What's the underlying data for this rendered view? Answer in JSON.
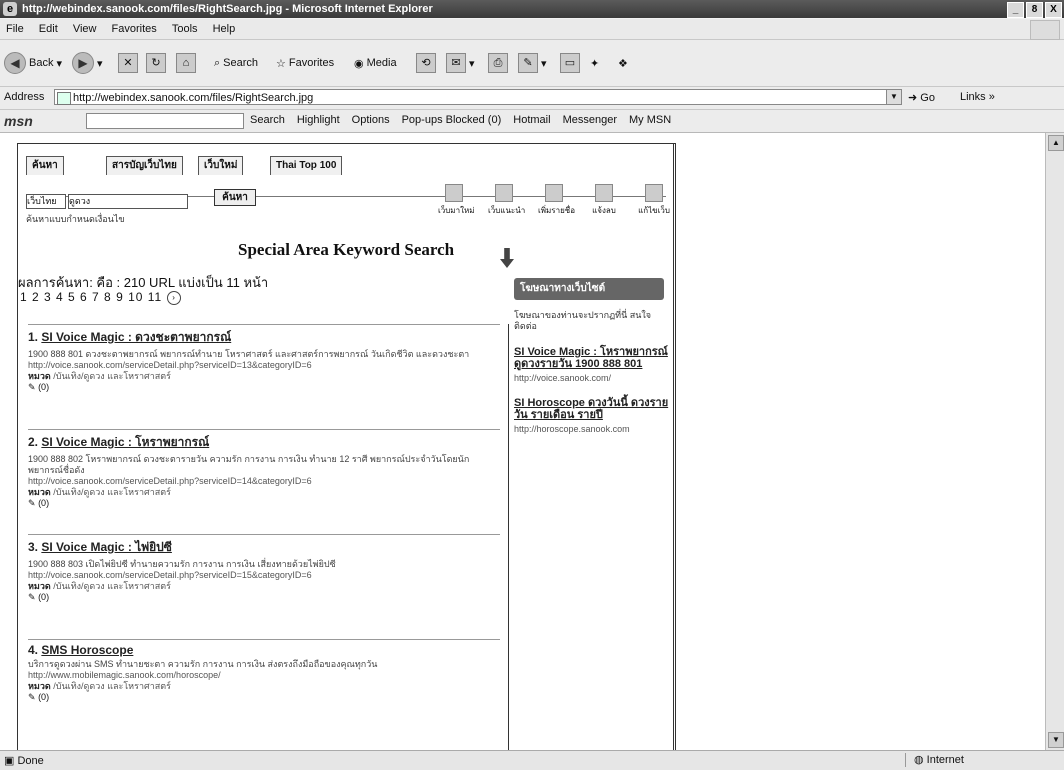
{
  "window": {
    "title": "http://webindex.sanook.com/files/RightSearch.jpg - Microsoft Internet Explorer",
    "controls": [
      "_",
      "8",
      "X"
    ]
  },
  "menu": [
    "File",
    "Edit",
    "View",
    "Favorites",
    "Tools",
    "Help"
  ],
  "toolbar": {
    "back": "Back",
    "search": "Search",
    "favorites": "Favorites",
    "media": "Media"
  },
  "address": {
    "label": "Address",
    "url": "http://webindex.sanook.com/files/RightSearch.jpg",
    "go": "Go",
    "links": "Links"
  },
  "msn": {
    "logo": "msn",
    "items": [
      "Search",
      "Highlight",
      "Options",
      "Pop-ups Blocked (0)",
      "Hotmail",
      "Messenger",
      "My MSN"
    ]
  },
  "status": {
    "left": "Done",
    "zone": "Internet"
  },
  "page": {
    "tabs": [
      "ค้นหา",
      "สารบัญเว็บไทย",
      "เว็บใหม่",
      "Thai Top 100"
    ],
    "search": {
      "scope": "เว็บไทย",
      "query": "ดูดวง",
      "button": "ค้นหา",
      "advanced": "ค้นหาแบบกำหนดเงื่อนไข"
    },
    "icons": [
      "เว็บมาใหม่",
      "เว็บแนะนำ",
      "เพิ่มรายชื่อ",
      "แจ้งลบ",
      "แก้ไขเว็บ"
    ],
    "heading": "Special Area Keyword Search",
    "summary": "ผลการค้นหา: คือ : 210 URL แบ่งเป็น 11 หน้า",
    "pages": "1 2 3 4 5 6 7 8 9 10 11",
    "results": [
      {
        "num": "1.",
        "title": "SI Voice Magic : ดวงชะตาพยากรณ์",
        "desc": "1900 888 801 ดวงชะตาพยากรณ์ พยากรณ์ทำนาย โหราศาสตร์ และศาสตร์การพยากรณ์ วันเกิดชีวิต และดวงชะตา",
        "url": "http://voice.sanook.com/serviceDetail.php?serviceID=13&categoryID=6",
        "cat_label": "หมวด",
        "cat": "/บันเทิง/ดูดวง และโหราศาสตร์",
        "foot": "(0)"
      },
      {
        "num": "2.",
        "title": "SI Voice Magic : โหราพยากรณ์",
        "desc": "1900 888 802 โหราพยากรณ์ ดวงชะตารายวัน ความรัก การงาน การเงิน ทำนาย 12 ราศี พยากรณ์ประจำวันโดยนักพยากรณ์ชื่อดัง",
        "url": "http://voice.sanook.com/serviceDetail.php?serviceID=14&categoryID=6",
        "cat_label": "หมวด",
        "cat": "/บันเทิง/ดูดวง และโหราศาสตร์",
        "foot": "(0)"
      },
      {
        "num": "3.",
        "title": "SI Voice Magic : ไพ่ยิปซี",
        "desc": "1900 888 803 เปิดไพ่ยิปซี ทำนายความรัก การงาน การเงิน เสี่ยงทายด้วยไพ่ยิปซี",
        "url": "http://voice.sanook.com/serviceDetail.php?serviceID=15&categoryID=6",
        "cat_label": "หมวด",
        "cat": "/บันเทิง/ดูดวง และโหราศาสตร์",
        "foot": "(0)"
      },
      {
        "num": "4.",
        "title": "SMS Horoscope",
        "desc": "บริการดูดวงผ่าน SMS ทำนายชะตา ความรัก การงาน การเงิน ส่งตรงถึงมือถือของคุณทุกวัน",
        "url": "http://www.mobilemagic.sanook.com/horoscope/",
        "cat_label": "หมวด",
        "cat": "/บันเทิง/ดูดวง และโหราศาสตร์",
        "foot": "(0)"
      }
    ],
    "side": {
      "badge": "โฆษณาทางเว็บไซต์",
      "note": "โฆษณาของท่านจะปรากฏที่นี่ สนใจติดต่อ",
      "ads": [
        {
          "title": "SI Voice Magic : โหราพยากรณ์ ดูดวงรายวัน 1900 888 801",
          "url": "http://voice.sanook.com/"
        },
        {
          "title": "SI Horoscope ดวงวันนี้ ดวงรายวัน รายเดือน รายปี",
          "url": "http://horoscope.sanook.com"
        }
      ]
    }
  }
}
